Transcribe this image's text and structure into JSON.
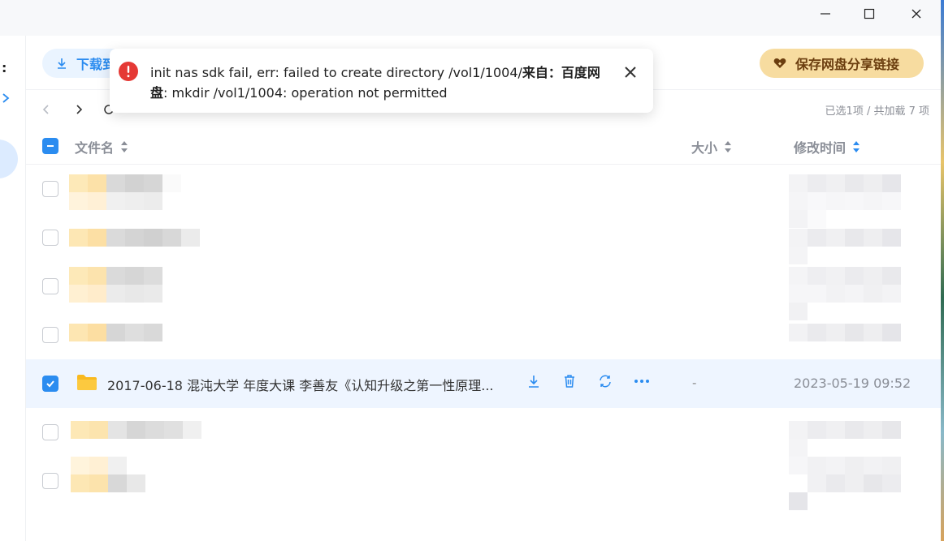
{
  "toolbar": {
    "download_label": "下载到",
    "save_share_label": "保存网盘分享链接"
  },
  "nav": {
    "path_hint": "... / ...",
    "selection_info": "已选1项 / 共加载 7 项"
  },
  "table": {
    "headers": {
      "name": "文件名",
      "size": "大小",
      "mtime": "修改时间"
    }
  },
  "rows": [
    {
      "checked": false,
      "blurred": true
    },
    {
      "checked": false,
      "blurred": true
    },
    {
      "checked": false,
      "blurred": true
    },
    {
      "checked": false,
      "blurred": true
    },
    {
      "checked": true,
      "blurred": false,
      "name": "2017-06-18 混沌大学 年度大课 李善友《认知升级之第一性原理...",
      "size": "-",
      "mtime": "2023-05-19 09:52"
    },
    {
      "checked": false,
      "blurred": true
    },
    {
      "checked": false,
      "blurred": true
    }
  ],
  "toast": {
    "line1_prefix": "init nas sdk fail, err: failed to create directory /vol1/1004/",
    "line1_bold": "来自：百度网",
    "line2_bold": "盘",
    "line2_rest": ": mkdir /vol1/1004: operation not permitted"
  },
  "colors": {
    "accent": "#2b8cf0",
    "error": "#e53935",
    "save_bg": "#f7dca0",
    "selected_row": "#eef5ff"
  },
  "icons": [
    "minimize-icon",
    "maximize-icon",
    "close-icon",
    "download-icon",
    "heart-icon",
    "back-icon",
    "forward-icon",
    "refresh-icon",
    "sort-icon",
    "folder-icon",
    "delete-icon",
    "sync-icon",
    "more-icon",
    "error-icon"
  ]
}
